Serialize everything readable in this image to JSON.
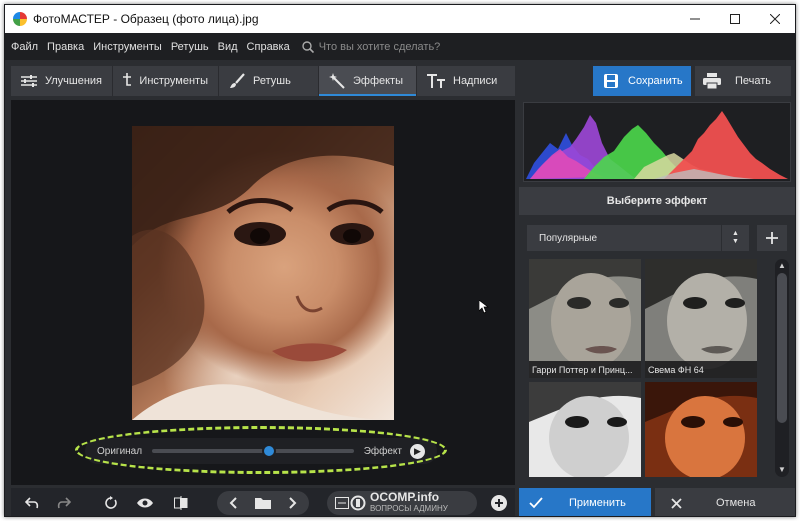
{
  "window": {
    "title": "ФотоМАСТЕР - Образец (фото лица).jpg"
  },
  "menu": {
    "items": [
      "Файл",
      "Правка",
      "Инструменты",
      "Ретушь",
      "Вид",
      "Справка"
    ],
    "search_placeholder": "Что вы хотите сделать?"
  },
  "tabs": [
    {
      "label": "Улучшения",
      "icon": "sliders-icon"
    },
    {
      "label": "Инструменты",
      "icon": "crop-icon"
    },
    {
      "label": "Ретушь",
      "icon": "brush-icon"
    },
    {
      "label": "Эффекты",
      "icon": "magic-wand-icon",
      "active": true
    },
    {
      "label": "Надписи",
      "icon": "text-icon"
    }
  ],
  "actions": {
    "save": "Сохранить",
    "print": "Печать",
    "apply": "Применить",
    "cancel": "Отмена"
  },
  "compare": {
    "left_label": "Оригинал",
    "right_label": "Эффект",
    "position": 0.58
  },
  "effects": {
    "header": "Выберите эффект",
    "category": "Популярные",
    "thumbnails": [
      {
        "caption": "Гарри Поттер и Принц..."
      },
      {
        "caption": "Свема ФН 64"
      },
      {
        "caption": ""
      },
      {
        "caption": ""
      }
    ]
  },
  "watermark": {
    "main": "OCOMP.info",
    "sub": "ВОПРОСЫ АДМИНУ"
  },
  "colors": {
    "accent": "#2777c8",
    "highlight_ring": "#b7e34a",
    "background": "#2b2d31"
  }
}
